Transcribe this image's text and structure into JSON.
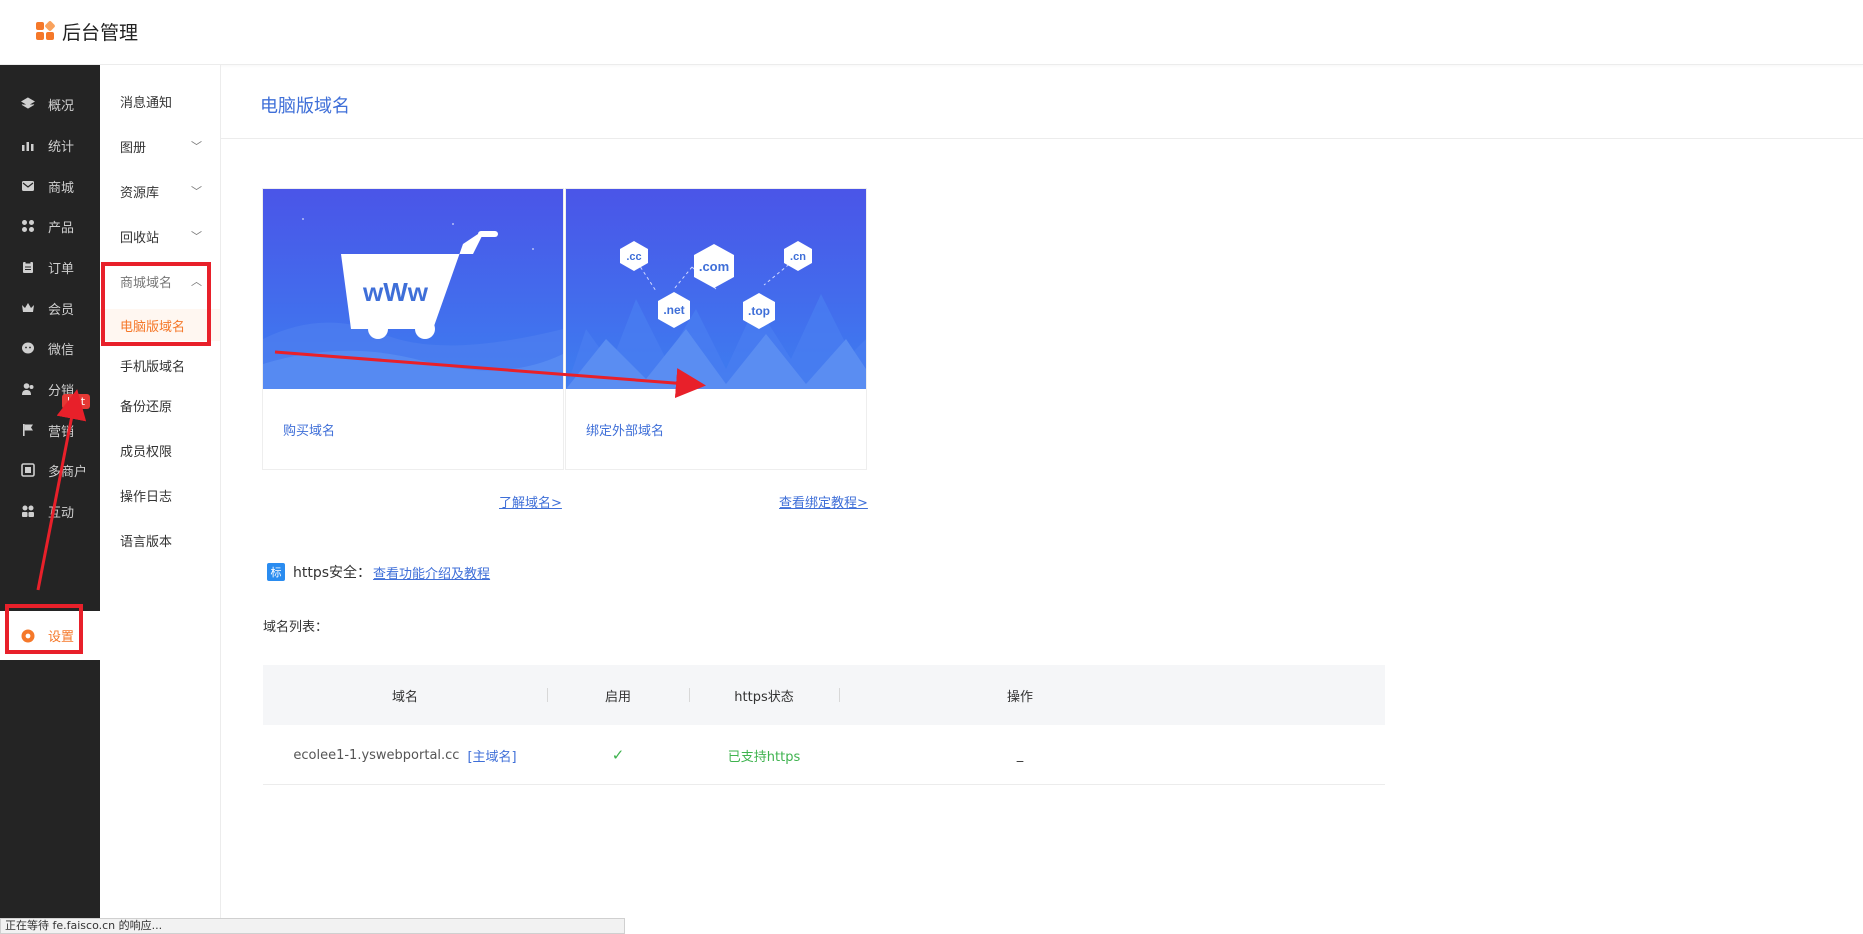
{
  "app": {
    "title": "后台管理"
  },
  "leftnav": {
    "items": [
      {
        "label": "概况",
        "icon": "layers-icon"
      },
      {
        "label": "统计",
        "icon": "chart-icon"
      },
      {
        "label": "商城",
        "icon": "mail-icon"
      },
      {
        "label": "产品",
        "icon": "grid-icon"
      },
      {
        "label": "订单",
        "icon": "clipboard-icon"
      },
      {
        "label": "会员",
        "icon": "crown-icon"
      },
      {
        "label": "微信",
        "icon": "wechat-icon"
      },
      {
        "label": "分销",
        "icon": "users-icon"
      },
      {
        "label": "营销",
        "icon": "flag-icon"
      },
      {
        "label": "多商户",
        "icon": "store-icon"
      },
      {
        "label": "互动",
        "icon": "people-icon"
      },
      {
        "label": "设置",
        "icon": "gear-icon"
      }
    ],
    "hot_badge": "hot",
    "active": "设置"
  },
  "subnav": {
    "items": [
      {
        "label": "消息通知"
      },
      {
        "label": "图册"
      },
      {
        "label": "资源库"
      },
      {
        "label": "回收站"
      },
      {
        "label": "商城域名"
      },
      {
        "label": "电脑版域名"
      },
      {
        "label": "手机版域名"
      },
      {
        "label": "备份还原"
      },
      {
        "label": "成员权限"
      },
      {
        "label": "操作日志"
      },
      {
        "label": "语言版本"
      }
    ]
  },
  "main": {
    "title": "电脑版域名",
    "cards": [
      {
        "caption": "购买域名",
        "link": "了解域名>"
      },
      {
        "caption": "绑定外部域名",
        "link": "查看绑定教程>"
      }
    ],
    "domain_tlds": [
      ".cc",
      ".com",
      ".cn",
      ".net",
      ".top"
    ],
    "https": {
      "badge": "标",
      "label": "https安全：",
      "link": "查看功能介绍及教程"
    },
    "list_label": "域名列表：",
    "table": {
      "headers": [
        "域名",
        "启用",
        "https状态",
        "操作"
      ],
      "rows": [
        {
          "domain": "ecolee1-1.yswebportal.cc",
          "tag": "[主域名]",
          "enabled": "✓",
          "https_status": "已支持https",
          "action": "_"
        }
      ]
    }
  },
  "statusbar": {
    "text": "正在等待 fe.faisco.cn 的响应..."
  },
  "colors": {
    "accent": "#f5782a",
    "link": "#3f6fd8",
    "nav_bg": "#242424",
    "annotation_red": "#e8202a",
    "success": "#3fb34f"
  }
}
